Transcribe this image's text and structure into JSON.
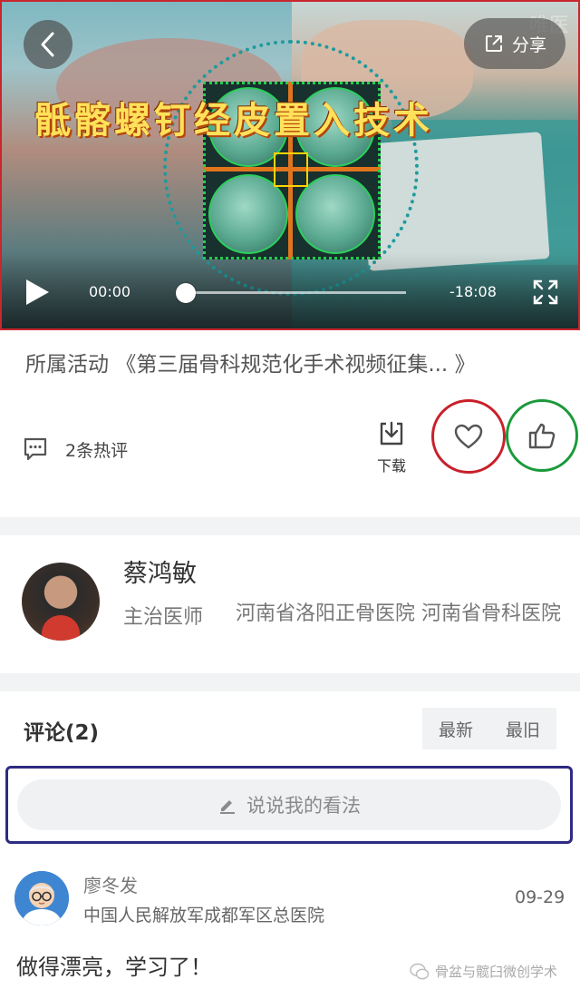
{
  "video": {
    "title_overlay": "骶髂螺钉经皮置入技术",
    "watermark": "唯医",
    "share_label": "分享",
    "current_time": "00:00",
    "remaining_time": "-18:08",
    "progress": 0
  },
  "activity": {
    "prefix": "所属活动",
    "name": "《第三届骨科规范化手术视频征集...",
    "suffix": "》"
  },
  "actions": {
    "comments_count_label": "2条热评",
    "download_label": "下载"
  },
  "author": {
    "name": "蔡鸿敏",
    "title": "主治医师",
    "organization": "河南省洛阳正骨医院 河南省骨科医院"
  },
  "comments": {
    "heading": "评论(2)",
    "sort_newest": "最新",
    "sort_oldest": "最旧",
    "input_placeholder": "说说我的看法",
    "items": [
      {
        "user": "廖冬发",
        "organization": "中国人民解放军成都军区总医院",
        "date": "09-29",
        "text": "做得漂亮，学习了！"
      }
    ]
  },
  "watermark_footer": "骨盆与髋臼微创学术",
  "colors": {
    "favorite_ring": "#c8202a",
    "like_ring": "#1a9a3a",
    "input_frame": "#2d2b82",
    "video_frame": "#c9262e"
  }
}
